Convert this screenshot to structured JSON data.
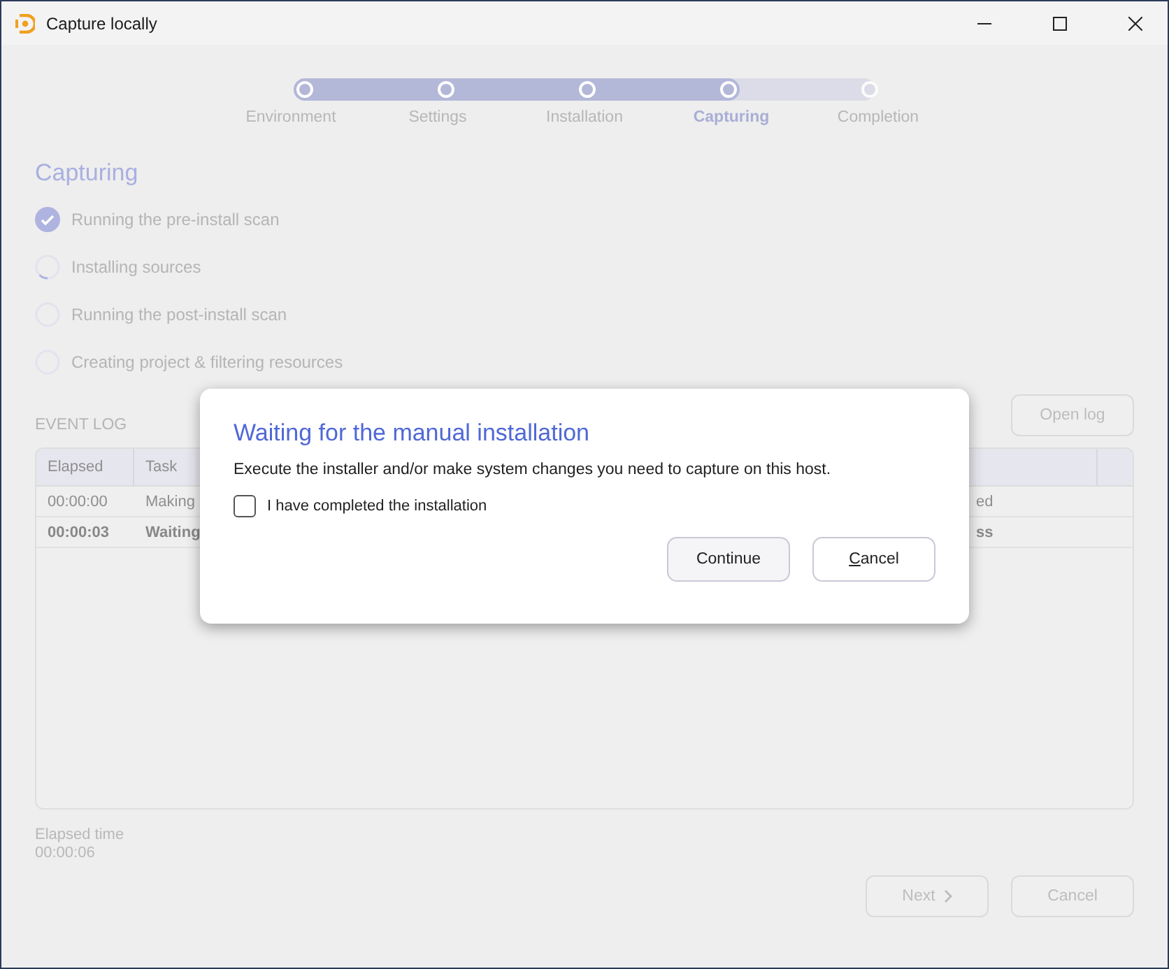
{
  "window": {
    "title": "Capture locally"
  },
  "steps": [
    {
      "label": "Environment",
      "selected": false
    },
    {
      "label": "Settings",
      "selected": false
    },
    {
      "label": "Installation",
      "selected": false
    },
    {
      "label": "Capturing",
      "selected": true
    },
    {
      "label": "Completion",
      "selected": false
    }
  ],
  "heading": "Capturing",
  "tasks": [
    {
      "label": "Running the pre-install scan",
      "kind": "done"
    },
    {
      "label": "Installing sources",
      "kind": "running"
    },
    {
      "label": "Running the post-install scan",
      "kind": "pending"
    },
    {
      "label": "Creating project & filtering resources",
      "kind": "pending"
    }
  ],
  "event_log": {
    "title": "EVENT LOG",
    "open_button": "Open log",
    "columns": [
      "Elapsed",
      "Task"
    ],
    "rows": [
      {
        "elapsed": "00:00:00",
        "task": "Making",
        "column_3": "ed",
        "current": false
      },
      {
        "elapsed": "00:00:03",
        "task": "Waiting",
        "column_3": "ss",
        "current": true
      }
    ]
  },
  "elapsed": {
    "label": "Elapsed time",
    "value": "00:00:06"
  },
  "buttons": {
    "next": "Next",
    "cancel": "Cancel"
  },
  "dialog": {
    "title": "Waiting for the manual installation",
    "message": "Execute the installer and/or make system changes you need to capture on this host.",
    "checkbox": {
      "label": "I have completed the installation",
      "checked": false
    },
    "buttons": [
      {
        "label": "Continue",
        "kind": "default"
      },
      {
        "label": "Cancel",
        "kind": "cancel"
      }
    ]
  }
}
